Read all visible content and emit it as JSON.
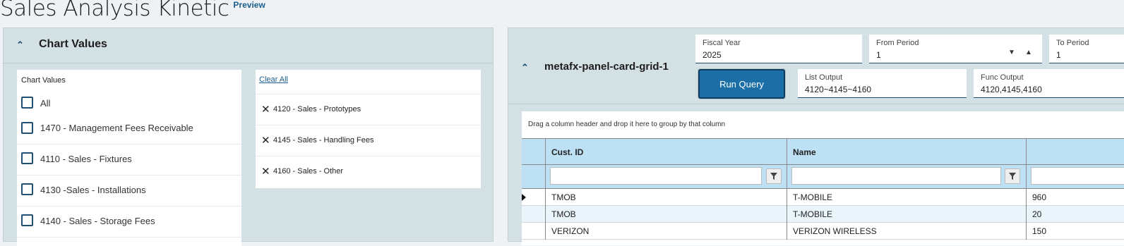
{
  "page": {
    "title": "Sales Analysis Kinetic",
    "badge": "Preview"
  },
  "left_panel": {
    "title": "Chart Values",
    "list_label": "Chart Values",
    "items": [
      {
        "label": "All",
        "checked": false
      },
      {
        "label": "1470 - Management Fees Receivable",
        "checked": false
      },
      {
        "label": "4110 - Sales - Fixtures",
        "checked": false
      },
      {
        "label": "4130 -Sales - Installations",
        "checked": false
      },
      {
        "label": "4140 - Sales - Storage Fees",
        "checked": false
      }
    ],
    "clear_all": "Clear All",
    "selected": [
      {
        "label": "4120 - Sales - Prototypes"
      },
      {
        "label": "4145 - Sales - Handling Fees"
      },
      {
        "label": "4160 - Sales - Other"
      }
    ]
  },
  "right_panel": {
    "title": "metafx-panel-card-grid-1",
    "fields": {
      "fiscal_year": {
        "label": "Fiscal Year",
        "value": "2025"
      },
      "from_period": {
        "label": "From Period",
        "value": "1"
      },
      "to_period": {
        "label": "To Period",
        "value": "1"
      },
      "list_output": {
        "label": "List Output",
        "value": "4120~4145~4160"
      },
      "func_output": {
        "label": "Func Output",
        "value": "4120,4145,4160"
      }
    },
    "run_query": "Run Query",
    "grid": {
      "group_hint": "Drag a column header and drop it here to group by that column",
      "columns": [
        "Cust. ID",
        "Name",
        ""
      ],
      "rows": [
        [
          "TMOB",
          "T-MOBILE",
          "960"
        ],
        [
          "TMOB",
          "T-MOBILE",
          "20"
        ],
        [
          "VERIZON",
          "VERIZON WIRELESS",
          "150"
        ]
      ]
    }
  },
  "colors": {
    "accent": "#1b6ea6",
    "header_bg": "#bde0f5",
    "panel_bg": "#d3e0e4"
  }
}
